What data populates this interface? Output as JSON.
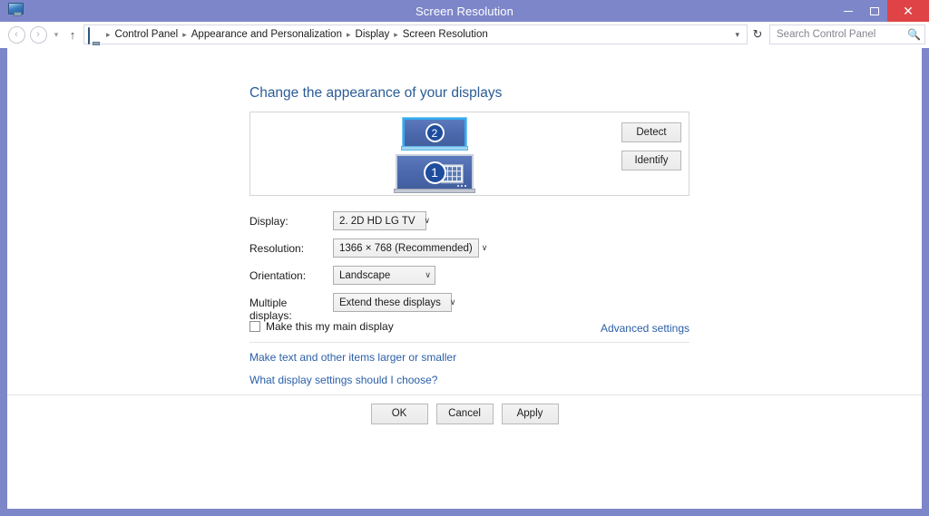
{
  "window": {
    "title": "Screen Resolution",
    "icon": "monitor-icon",
    "controls": {
      "minimize": "–",
      "maximize": "□",
      "close": "✕"
    }
  },
  "addressbar": {
    "back_icon": "‹",
    "forward_icon": "›",
    "history_caret": "▾",
    "up_icon": "↑",
    "crumb_icon": "monitor-icon",
    "breadcrumbs": [
      "Control Panel",
      "Appearance and Personalization",
      "Display",
      "Screen Resolution"
    ],
    "separator": "▸",
    "dropdown_caret": "▾",
    "refresh_icon": "↻",
    "search": {
      "placeholder": "Search Control Panel",
      "value": "",
      "icon": "search-icon"
    }
  },
  "main": {
    "heading": "Change the appearance of your displays",
    "preview": {
      "monitor_2_label": "2",
      "monitor_1_label": "1",
      "selected_monitor": "2",
      "detect_label": "Detect",
      "identify_label": "Identify"
    },
    "fields": {
      "display": {
        "label": "Display:",
        "value": "2. 2D HD LG TV",
        "caret": "∨"
      },
      "resolution": {
        "label": "Resolution:",
        "value": "1366 × 768 (Recommended)",
        "caret": "∨"
      },
      "orientation": {
        "label": "Orientation:",
        "value": "Landscape",
        "caret": "∨"
      },
      "multiple_displays": {
        "label": "Multiple displays:",
        "value": "Extend these displays",
        "caret": "∨"
      }
    },
    "main_display_checkbox": {
      "label": "Make this my main display",
      "checked": false
    },
    "advanced_settings_link": "Advanced settings",
    "links": [
      "Make text and other items larger or smaller",
      "What display settings should I choose?"
    ]
  },
  "footer": {
    "ok_label": "OK",
    "cancel_label": "Cancel",
    "apply_label": "Apply"
  },
  "colors": {
    "window_chrome": "#7d86c9",
    "close_button": "#e04345",
    "heading_blue": "#2b5c97",
    "link_blue": "#2a5fa8",
    "monitor_fill": "#4b68ad",
    "selection_outline": "#35aaf0",
    "badge_blue": "#1f4d9e"
  }
}
